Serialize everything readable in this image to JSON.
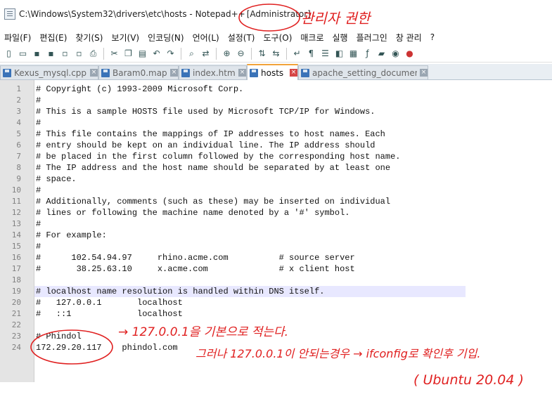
{
  "window": {
    "title": "C:\\Windows\\System32\\drivers\\etc\\hosts - Notepad++",
    "admin_label": "[Administrator]"
  },
  "menu": [
    "파일(F)",
    "편집(E)",
    "찾기(S)",
    "보기(V)",
    "인코딩(N)",
    "언어(L)",
    "설정(T)",
    "도구(O)",
    "매크로",
    "실행",
    "플러그인",
    "창 관리",
    "?"
  ],
  "toolbar_icons": [
    "new-file-icon",
    "open-file-icon",
    "save-icon",
    "save-all-icon",
    "close-icon",
    "close-all-icon",
    "print-icon",
    "cut-icon",
    "copy-icon",
    "paste-icon",
    "undo-icon",
    "redo-icon",
    "find-icon",
    "replace-icon",
    "zoom-in-icon",
    "zoom-out-icon",
    "sync-vertical-icon",
    "sync-horizontal-icon",
    "word-wrap-icon",
    "show-all-chars-icon",
    "indent-guide-icon",
    "language-icon",
    "map-icon",
    "function-list-icon",
    "folder-icon",
    "monitor-icon",
    "record-icon"
  ],
  "tabs": [
    {
      "label": "Kexus_mysql.cpp",
      "active": false
    },
    {
      "label": "Baram0.map",
      "active": false
    },
    {
      "label": "index.html",
      "active": false
    },
    {
      "label": "hosts",
      "active": true
    },
    {
      "label": "apache_setting_document",
      "active": false
    }
  ],
  "editor": {
    "current_line": 19,
    "lines": [
      {
        "n": "1",
        "text": "# Copyright (c) 1993-2009 Microsoft Corp."
      },
      {
        "n": "2",
        "text": "#"
      },
      {
        "n": "3",
        "text": "# This is a sample HOSTS file used by Microsoft TCP/IP for Windows."
      },
      {
        "n": "4",
        "text": "#"
      },
      {
        "n": "5",
        "text": "# This file contains the mappings of IP addresses to host names. Each"
      },
      {
        "n": "6",
        "text": "# entry should be kept on an individual line. The IP address should"
      },
      {
        "n": "7",
        "text": "# be placed in the first column followed by the corresponding host name."
      },
      {
        "n": "8",
        "text": "# The IP address and the host name should be separated by at least one"
      },
      {
        "n": "9",
        "text": "# space."
      },
      {
        "n": "10",
        "text": "#"
      },
      {
        "n": "11",
        "text": "# Additionally, comments (such as these) may be inserted on individual"
      },
      {
        "n": "12",
        "text": "# lines or following the machine name denoted by a '#' symbol."
      },
      {
        "n": "13",
        "text": "#"
      },
      {
        "n": "14",
        "text": "# For example:"
      },
      {
        "n": "15",
        "text": "#"
      },
      {
        "n": "16",
        "text": "#      102.54.94.97     rhino.acme.com          # source server"
      },
      {
        "n": "17",
        "text": "#       38.25.63.10     x.acme.com              # x client host"
      },
      {
        "n": "18",
        "text": ""
      },
      {
        "n": "19",
        "text": "# localhost name resolution is handled within DNS itself."
      },
      {
        "n": "20",
        "text": "#   127.0.0.1       localhost"
      },
      {
        "n": "21",
        "text": "#   ::1             localhost"
      },
      {
        "n": "22",
        "text": ""
      },
      {
        "n": "23",
        "text": "# Phindol"
      },
      {
        "n": "24",
        "text": "172.29.20.117    phindol.com"
      }
    ]
  },
  "annotations": {
    "admin_note": "관리자 권한",
    "loopback_note": "→ 127.0.0.1을 기본으로 적는다.",
    "ifconfig_note": "그러나 127.0.0.1이 안되는경우 → ifconfig로 확인후 기입.",
    "os_note": "( Ubuntu 20.04 )",
    "color": "#e02020"
  }
}
